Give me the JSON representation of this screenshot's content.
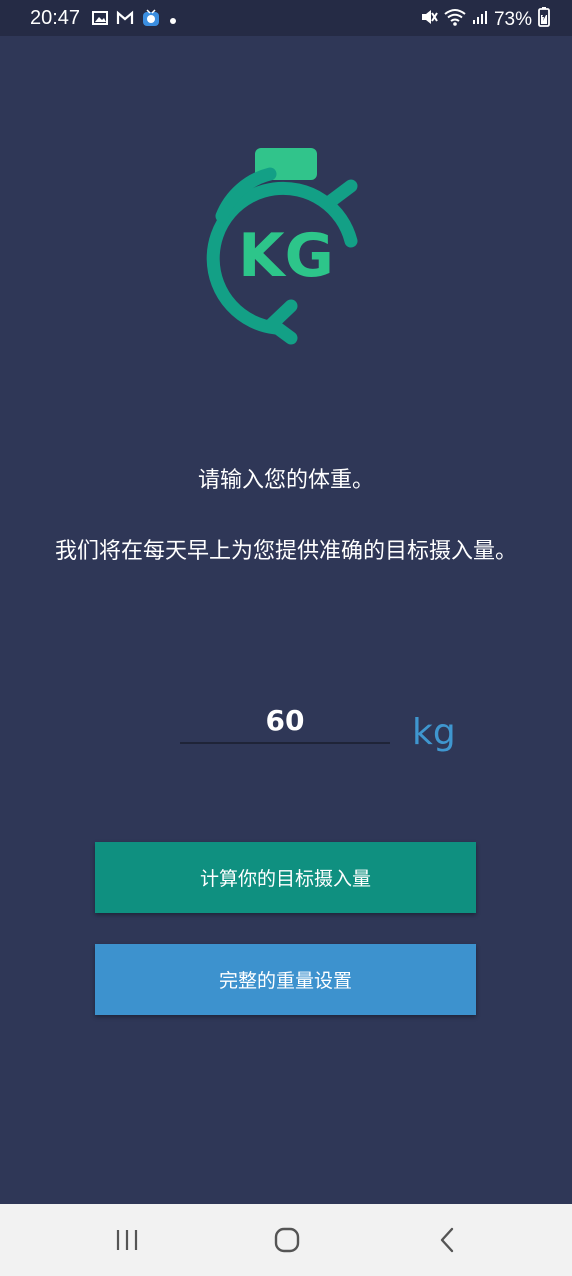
{
  "status_bar": {
    "time": "20:47",
    "battery": "73%",
    "icons": [
      "image-icon",
      "gmail-icon",
      "app-tv-icon",
      "dot-icon",
      "mute-icon",
      "wifi-icon",
      "signal-icon",
      "battery-icon"
    ]
  },
  "logo": {
    "text": "KG",
    "colors": {
      "ring": "#13a086",
      "top": "#31c48b",
      "text": "#2dc58a"
    }
  },
  "prompt": {
    "line1": "请输入您的体重。",
    "line2": "我们将在每天早上为您提供准确的目标摄入量。"
  },
  "weight": {
    "value": "60",
    "unit": "kg"
  },
  "buttons": {
    "calculate": "计算你的目标摄入量",
    "full_settings": "完整的重量设置"
  },
  "colors": {
    "background": "#2f3757",
    "status_bar": "#252b45",
    "calc_button": "#0f9080",
    "settings_button": "#3d92ce",
    "unit_text": "#3f96cf"
  },
  "nav": {
    "icons": [
      "recent-apps-icon",
      "home-icon",
      "back-icon"
    ]
  }
}
